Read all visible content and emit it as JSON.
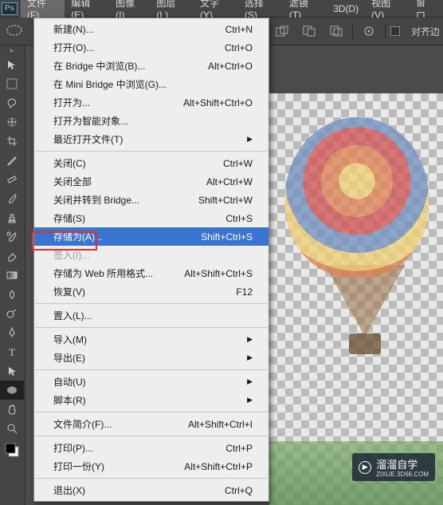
{
  "menubar": {
    "items": [
      "文件(F)",
      "编辑(E)",
      "图像(I)",
      "图层(L)",
      "文字(Y)",
      "选择(S)",
      "滤镜(T)",
      "3D(D)",
      "视图(V)",
      "窗口"
    ],
    "active_index": 0
  },
  "options_bar": {
    "align_edges_label": "对齐边"
  },
  "dropdown": {
    "items": [
      {
        "label": "新建(N)...",
        "shortcut": "Ctrl+N"
      },
      {
        "label": "打开(O)...",
        "shortcut": "Ctrl+O"
      },
      {
        "label": "在 Bridge 中浏览(B)...",
        "shortcut": "Alt+Ctrl+O"
      },
      {
        "label": "在 Mini Bridge 中浏览(G)..."
      },
      {
        "label": "打开为...",
        "shortcut": "Alt+Shift+Ctrl+O"
      },
      {
        "label": "打开为智能对象..."
      },
      {
        "label": "最近打开文件(T)",
        "arrow": true
      },
      {
        "sep": true
      },
      {
        "label": "关闭(C)",
        "shortcut": "Ctrl+W"
      },
      {
        "label": "关闭全部",
        "shortcut": "Alt+Ctrl+W"
      },
      {
        "label": "关闭并转到 Bridge...",
        "shortcut": "Shift+Ctrl+W"
      },
      {
        "label": "存储(S)",
        "shortcut": "Ctrl+S"
      },
      {
        "label": "存储为(A)...",
        "shortcut": "Shift+Ctrl+S",
        "highlighted": true
      },
      {
        "label": "签入(I)...",
        "disabled": true
      },
      {
        "label": "存储为 Web 所用格式...",
        "shortcut": "Alt+Shift+Ctrl+S"
      },
      {
        "label": "恢复(V)",
        "shortcut": "F12"
      },
      {
        "sep": true
      },
      {
        "label": "置入(L)..."
      },
      {
        "sep": true
      },
      {
        "label": "导入(M)",
        "arrow": true
      },
      {
        "label": "导出(E)",
        "arrow": true
      },
      {
        "sep": true
      },
      {
        "label": "自动(U)",
        "arrow": true
      },
      {
        "label": "脚本(R)",
        "arrow": true
      },
      {
        "sep": true
      },
      {
        "label": "文件简介(F)...",
        "shortcut": "Alt+Shift+Ctrl+I"
      },
      {
        "sep": true
      },
      {
        "label": "打印(P)...",
        "shortcut": "Ctrl+P"
      },
      {
        "label": "打印一份(Y)",
        "shortcut": "Alt+Shift+Ctrl+P"
      },
      {
        "sep": true
      },
      {
        "label": "退出(X)",
        "shortcut": "Ctrl+Q"
      }
    ]
  },
  "watermark": {
    "brand": "溜溜自学",
    "domain": "ZIXUE.3D66.COM"
  }
}
